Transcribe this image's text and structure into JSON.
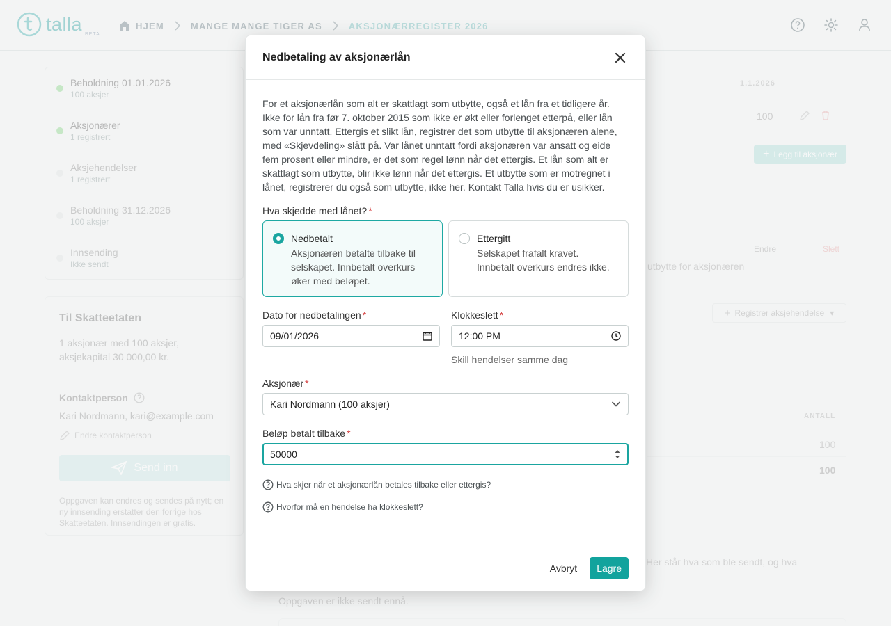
{
  "header": {
    "logo_text": "talla",
    "logo_badge": "BETA",
    "breadcrumb": [
      "HJEM",
      "MANGE MANGE TIGER AS",
      "AKSJONÆRREGISTER 2026"
    ],
    "icons": [
      "help-icon",
      "theme-icon",
      "user-icon"
    ]
  },
  "background": {
    "steps": [
      {
        "label": "Beholdning 01.01.2026",
        "sub": "100 aksjer"
      },
      {
        "label": "Aksjonærer",
        "sub": "1 registrert"
      },
      {
        "label": "Aksjehendelser",
        "sub": "1 registrert"
      },
      {
        "label": "Beholdning 31.12.2026",
        "sub": "100 aksjer"
      },
      {
        "label": "Innsending",
        "sub": "Ikke sendt"
      }
    ],
    "skatt": {
      "title": "Til Skatteetaten",
      "summary": "1 aksjonær med 100 aksjer, aksjekapital 30 000,00 kr.",
      "contact_label": "Kontaktperson",
      "contact_value": "Kari Nordmann, kari@example.com",
      "edit_contact": "Endre kontaktperson",
      "send_button": "Send inn",
      "note": "Oppgaven kan endres og sendes på nytt; en ny innsending erstatter den forrige hos Skatteetaten. Innsendingen er gratis."
    },
    "table_date": "1.1.2026",
    "table_value": "100",
    "add_shareholder": "Legg til aksjonær",
    "edit": "Endre",
    "delete": "Slett",
    "event_snippet": "utbytte for aksjonæren",
    "register_event": "Registrer aksjehendelse",
    "antall_header": "ANTALL",
    "antall_row": "100",
    "antall_total": "100",
    "sent_snippet": "Her står hva som ble sendt, og hva",
    "not_sent": "Oppgaven er ikke sendt ennå."
  },
  "modal": {
    "title": "Nedbetaling av aksjonærlån",
    "intro": "For et aksjonærlån som alt er skattlagt som utbytte, også et lån fra et tidligere år. Ikke for lån fra før 7. oktober 2015 som ikke er økt eller forlenget etterpå, eller lån som var unntatt. Ettergis et slikt lån, registrer det som utbytte til aksjonæren alene, med «Skjevdeling» slått på. Var lånet unntatt fordi aksjonæren var ansatt og eide fem prosent eller mindre, er det som regel lønn når det ettergis. Et lån som alt er skattlagt som utbytte, blir ikke lønn når det ettergis. Et utbytte som er motregnet i lånet, registrerer du også som utbytte, ikke her. Kontakt Talla hvis du er usikker.",
    "question_label": "Hva skjedde med lånet?",
    "options": [
      {
        "title": "Nedbetalt",
        "desc": "Aksjonæren betalte tilbake til selskapet. Innbetalt overkurs øker med beløpet.",
        "selected": true
      },
      {
        "title": "Ettergitt",
        "desc": "Selskapet frafalt kravet. Innbetalt overkurs endres ikke.",
        "selected": false
      }
    ],
    "date_label": "Dato for nedbetalingen",
    "date_value": "09/01/2026",
    "time_label": "Klokkeslett",
    "time_value": "12:00 PM",
    "time_hint": "Skill hendelser samme dag",
    "shareholder_label": "Aksjonær",
    "shareholder_value": "Kari Nordmann (100 aksjer)",
    "amount_label": "Beløp betalt tilbake",
    "amount_value": "50000",
    "help_links": [
      "Hva skjer når et aksjonærlån betales tilbake eller ettergis?",
      "Hvorfor må en hendelse ha klokkeslett?"
    ],
    "cancel": "Avbryt",
    "save": "Lagre"
  },
  "colors": {
    "accent": "#12a39d",
    "required": "#d43c3c",
    "background": "#f3f5f5"
  }
}
